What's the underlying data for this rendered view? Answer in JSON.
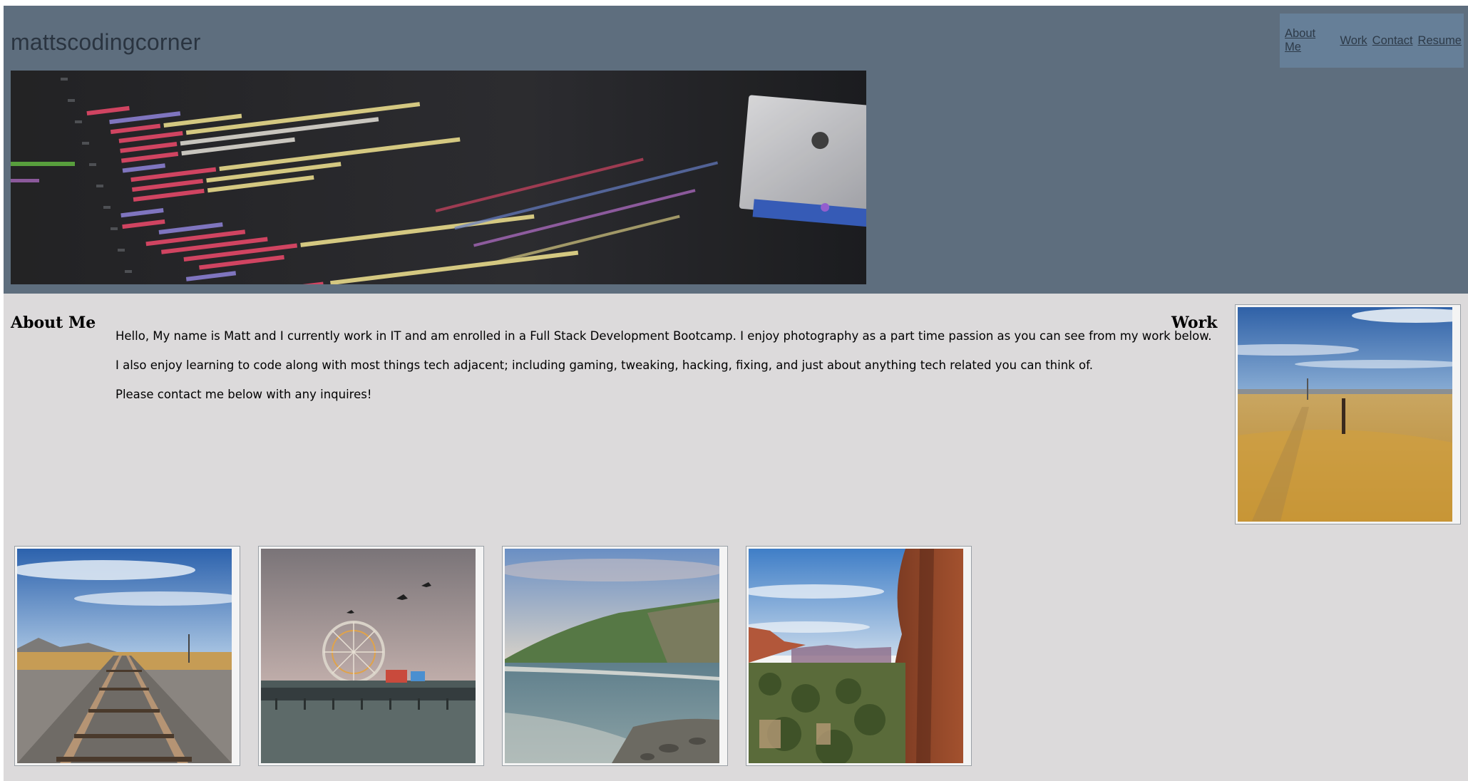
{
  "site": {
    "logo": "mattscodingcorner"
  },
  "nav": {
    "items": [
      "About Me",
      "Work",
      "Contact",
      "Resume"
    ]
  },
  "about": {
    "heading": "About Me",
    "paragraphs": [
      "Hello, My name is Matt and I currently work in IT and am enrolled in a Full Stack Development Bootcamp. I enjoy photography as a part time passion as you can see from my work below.",
      "I also enjoy learning to code along with most things tech adjacent; including gaming, tweaking, hacking, fixing, and just about anything tech related you can think of.",
      "Please contact me below with any inquires!"
    ]
  },
  "work": {
    "heading": "Work"
  },
  "colors": {
    "header_bg": "#5e6e7e",
    "nav_bg": "#667f98",
    "page_bg": "#dcdadb"
  }
}
